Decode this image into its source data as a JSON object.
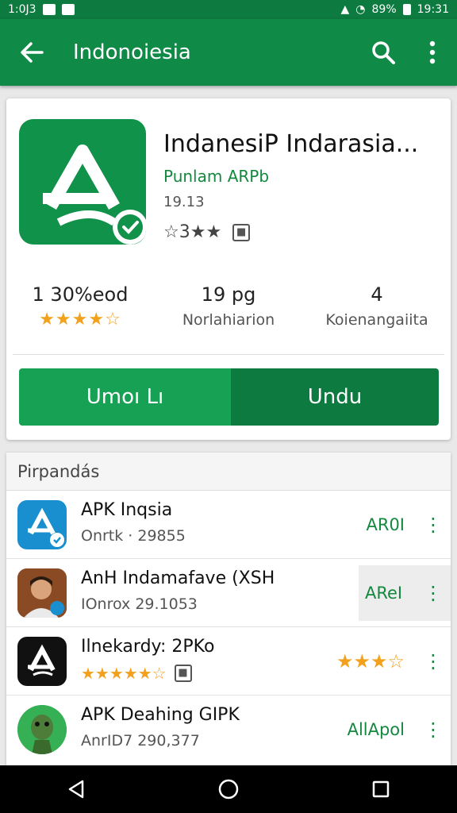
{
  "status_bar": {
    "time_left": "1:0J3",
    "battery": "89%",
    "time_right": "19:31"
  },
  "toolbar": {
    "title": "Indonoiesia",
    "icons": [
      "back-arrow-icon",
      "search-icon",
      "more-vert-icon"
    ]
  },
  "app": {
    "title": "IndanesiP Indarasia...",
    "developer": "Punlam ARPb",
    "meta": "19.13",
    "rating_text": "☆3★★",
    "brand_color": "#11924a"
  },
  "stats": [
    {
      "value": "1 30%eod",
      "label": "★★★★☆",
      "is_stars": true
    },
    {
      "value": "19 pg",
      "label": "Norlahiarion",
      "is_stars": false
    },
    {
      "value": "4",
      "label": "Koienangaiita",
      "is_stars": false
    }
  ],
  "buttons": {
    "left": "Umoı Lı",
    "right": "Undu",
    "left_color": "#17a155",
    "right_color": "#0d7a3f"
  },
  "related": {
    "header": "Pirpandás",
    "items": [
      {
        "title": "APK Inqsia",
        "sub": "Onrtk · 29855",
        "action": "AR0I"
      },
      {
        "title": "AnH Indamafave (XSH",
        "sub": "IOnrox 29.1053",
        "action": "AReI"
      },
      {
        "title": "Ilnekardy: 2PKo",
        "stars": "★★★★★☆",
        "right_stars": "★★★☆"
      },
      {
        "title": "APK Deahing GIPK",
        "sub": "AnrID7 290,377",
        "action": "AllApol"
      }
    ]
  }
}
